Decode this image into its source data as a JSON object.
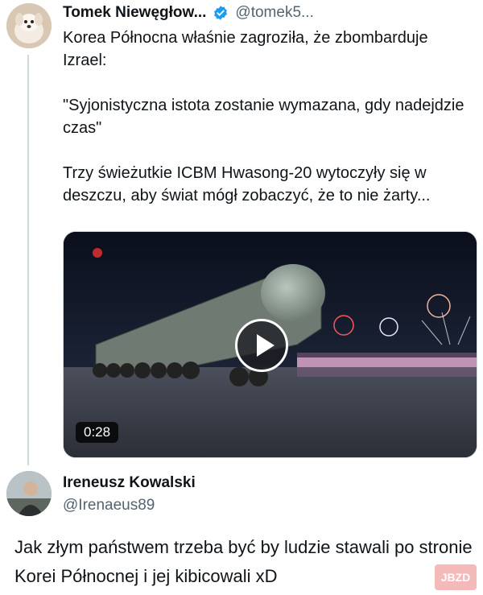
{
  "tweet": {
    "display_name": "Tomek Niewęgłow...",
    "handle": "@tomek5...",
    "verified_icon": "verified-badge-icon",
    "text_paragraphs": [
      "Korea Północna właśnie zagroziła, że zbombarduje Izrael:",
      "\"Syjonistyczna istota zostanie wymazana, gdy nadejdzie czas\"",
      "Trzy świeżutkie ICBM Hwasong-20 wytoczyły się w deszczu, aby świat mógł zobaczyć, że to nie żarty..."
    ],
    "video": {
      "duration": "0:28",
      "play_icon": "play-icon"
    }
  },
  "reply": {
    "display_name": "Ireneusz Kowalski",
    "handle": "@Irenaeus89"
  },
  "caption": "Jak złym państwem trzeba być by ludzie stawali po stronie Korei Północnej i jej kibicowali xD",
  "watermark": "JBZD",
  "colors": {
    "text": "#0f1419",
    "muted": "#536471",
    "verified": "#1d9bf0",
    "thread_line": "#cfd9de"
  }
}
